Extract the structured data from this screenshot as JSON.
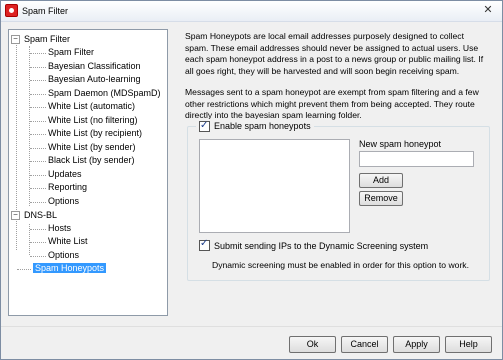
{
  "window": {
    "title": "Spam Filter",
    "close_glyph": "✕"
  },
  "tree": {
    "root1": "Spam Filter",
    "root1_children": [
      "Spam Filter",
      "Bayesian Classification",
      "Bayesian Auto-learning",
      "Spam Daemon (MDSpamD)",
      "White List (automatic)",
      "White List (no filtering)",
      "White List (by recipient)",
      "White List (by sender)",
      "Black List (by sender)",
      "Updates",
      "Reporting",
      "Options"
    ],
    "root2": "DNS-BL",
    "root2_children": [
      "Hosts",
      "White List",
      "Options"
    ],
    "root3": "Spam Honeypots",
    "expand_glyph": "−"
  },
  "description": {
    "para1": "Spam Honeypots are local email addresses purposely designed to collect spam. These email addresses should never be assigned to actual users. Use each spam honeypot address in a post to a news group or public mailing list. If all goes right, they will be harvested and will soon begin receiving spam.",
    "para2": "Messages sent to a spam honeypot are exempt from spam filtering and a few other restrictions which might prevent them from being accepted. They route directly into the bayesian spam learning folder."
  },
  "honeypots": {
    "enable_label": "Enable spam honeypots",
    "enable_checked": true,
    "new_label": "New spam honeypot",
    "new_value": "",
    "add_label": "Add",
    "remove_label": "Remove",
    "list_items": []
  },
  "screening": {
    "submit_label": "Submit sending IPs to the Dynamic Screening system",
    "submit_checked": true,
    "note": "Dynamic screening must be enabled in order for this option to work."
  },
  "footer": {
    "ok_label": "Ok",
    "cancel_label": "Cancel",
    "apply_label": "Apply",
    "help_label": "Help"
  }
}
